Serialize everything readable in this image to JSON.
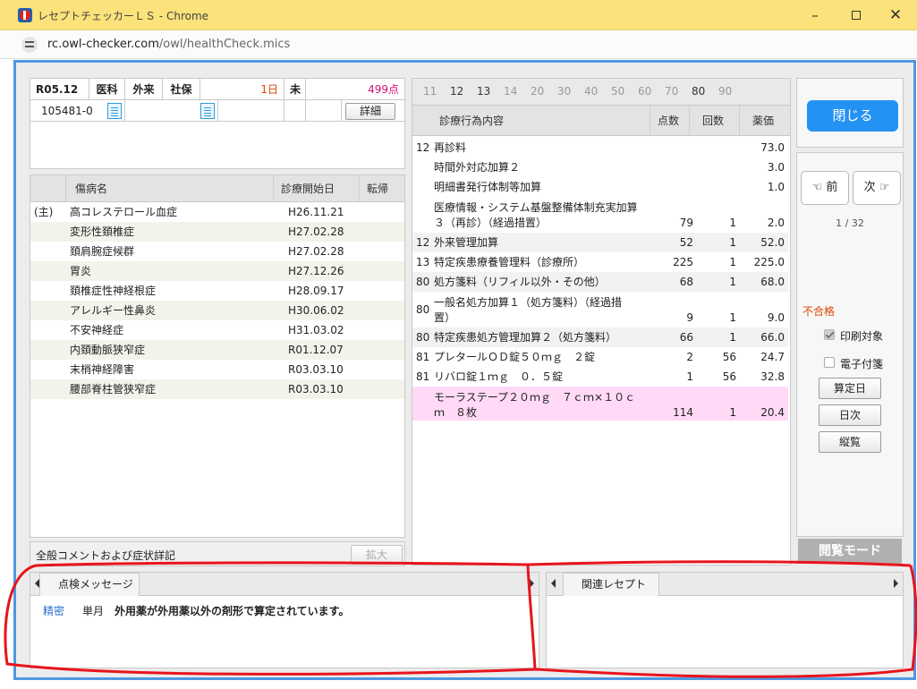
{
  "window": {
    "title": "レセプトチェッカーＬＳ - Chrome",
    "url_host": "rc.owl-checker.com",
    "url_path": "/owl/healthCheck.mics"
  },
  "header_info": {
    "date": "R05.12",
    "dept": "医科",
    "visit": "外来",
    "insurance": "社保",
    "days": "1日",
    "status": "未",
    "points": "499点",
    "patient_id": "105481-0",
    "detail_btn": "詳細"
  },
  "diagnosis": {
    "headers": [
      "傷病名",
      "診療開始日",
      "転帰"
    ],
    "rows": [
      {
        "prefix": "(主)",
        "name": "高コレステロール血症",
        "date": "H26.11.21",
        "outcome": ""
      },
      {
        "prefix": "",
        "name": "変形性頚椎症",
        "date": "H27.02.28",
        "outcome": ""
      },
      {
        "prefix": "",
        "name": "頚肩腕症候群",
        "date": "H27.02.28",
        "outcome": ""
      },
      {
        "prefix": "",
        "name": "胃炎",
        "date": "H27.12.26",
        "outcome": ""
      },
      {
        "prefix": "",
        "name": "頚椎症性神経根症",
        "date": "H28.09.17",
        "outcome": ""
      },
      {
        "prefix": "",
        "name": "アレルギー性鼻炎",
        "date": "H30.06.02",
        "outcome": ""
      },
      {
        "prefix": "",
        "name": "不安神経症",
        "date": "H31.03.02",
        "outcome": ""
      },
      {
        "prefix": "",
        "name": "内頚動脈狭窄症",
        "date": "R01.12.07",
        "outcome": ""
      },
      {
        "prefix": "",
        "name": "末梢神経障害",
        "date": "R03.03.10",
        "outcome": ""
      },
      {
        "prefix": "",
        "name": "腰部脊柱管狭窄症",
        "date": "R03.03.10",
        "outcome": ""
      }
    ],
    "comment_label": "全般コメントおよび症状詳記",
    "expand_btn": "拡大"
  },
  "procedures": {
    "num_tabs": [
      "11",
      "12",
      "13",
      "14",
      "20",
      "30",
      "40",
      "50",
      "60",
      "70",
      "80",
      "90"
    ],
    "headers": [
      "診療行為内容",
      "点数",
      "回数",
      "薬価"
    ],
    "rows": [
      {
        "code": "12",
        "lines": [
          "再診料"
        ],
        "points": "",
        "count": "",
        "price": "73.0"
      },
      {
        "code": "",
        "lines": [
          "時間外対応加算２"
        ],
        "points": "",
        "count": "",
        "price": "3.0"
      },
      {
        "code": "",
        "lines": [
          "明細書発行体制等加算"
        ],
        "points": "",
        "count": "",
        "price": "1.0"
      },
      {
        "code": "",
        "lines": [
          "医療情報・システム基盤整備体制充実加算",
          "３（再診）（経過措置）"
        ],
        "points": "79",
        "count": "1",
        "price": "2.0"
      },
      {
        "code": "12",
        "lines": [
          "外来管理加算"
        ],
        "points": "52",
        "count": "1",
        "price": "52.0"
      },
      {
        "code": "13",
        "lines": [
          "特定疾患療養管理料（診療所）"
        ],
        "points": "225",
        "count": "1",
        "price": "225.0"
      },
      {
        "code": "80",
        "lines": [
          "処方箋料（リフィル以外・その他）"
        ],
        "points": "68",
        "count": "1",
        "price": "68.0"
      },
      {
        "code": "80",
        "lines": [
          "一般名処方加算１（処方箋料）（経過措",
          "置）"
        ],
        "points": "9",
        "count": "1",
        "price": "9.0"
      },
      {
        "code": "80",
        "lines": [
          "特定疾患処方管理加算２（処方箋料）"
        ],
        "points": "66",
        "count": "1",
        "price": "66.0"
      },
      {
        "code": "81",
        "lines": [
          "プレタールＯＤ錠５０ｍｇ　２錠"
        ],
        "points": "2",
        "count": "56",
        "price": "24.7"
      },
      {
        "code": "81",
        "lines": [
          "リバロ錠１ｍｇ　０．５錠"
        ],
        "points": "1",
        "count": "56",
        "price": "32.8"
      },
      {
        "code": "",
        "lines": [
          "モーラステープ２０ｍｇ　７ｃｍ×１０ｃ",
          "ｍ　８枚"
        ],
        "points": "114",
        "count": "1",
        "price": "20.4"
      }
    ]
  },
  "sidebar": {
    "close_btn": "閉じる",
    "prev_btn": "前",
    "next_btn": "次",
    "page_indicator": "1 / 32",
    "result_label": "不合格",
    "print_target": "印刷対象",
    "e_attach": "電子付箋",
    "calc_date_btn": "算定日",
    "daily_btn": "日次",
    "overview_btn": "縦覧",
    "mode_label": "閲覧モード"
  },
  "messages": {
    "tab_label": "点検メッセージ",
    "row": {
      "type": "精密",
      "period": "単月",
      "text": "外用薬が外用薬以外の剤形で算定されています。"
    }
  },
  "related": {
    "tab_label": "関連レセプト"
  },
  "colors": {
    "titlebar": "#fbe27a",
    "frame_border": "#4f97e1",
    "accent_blue": "#2492f2",
    "points_pink": "#d0107a",
    "days_orange": "#e04600",
    "fail_orange": "#e04600",
    "highlight_row": "#ffd9f5",
    "annotation_red": "#e8141c"
  }
}
